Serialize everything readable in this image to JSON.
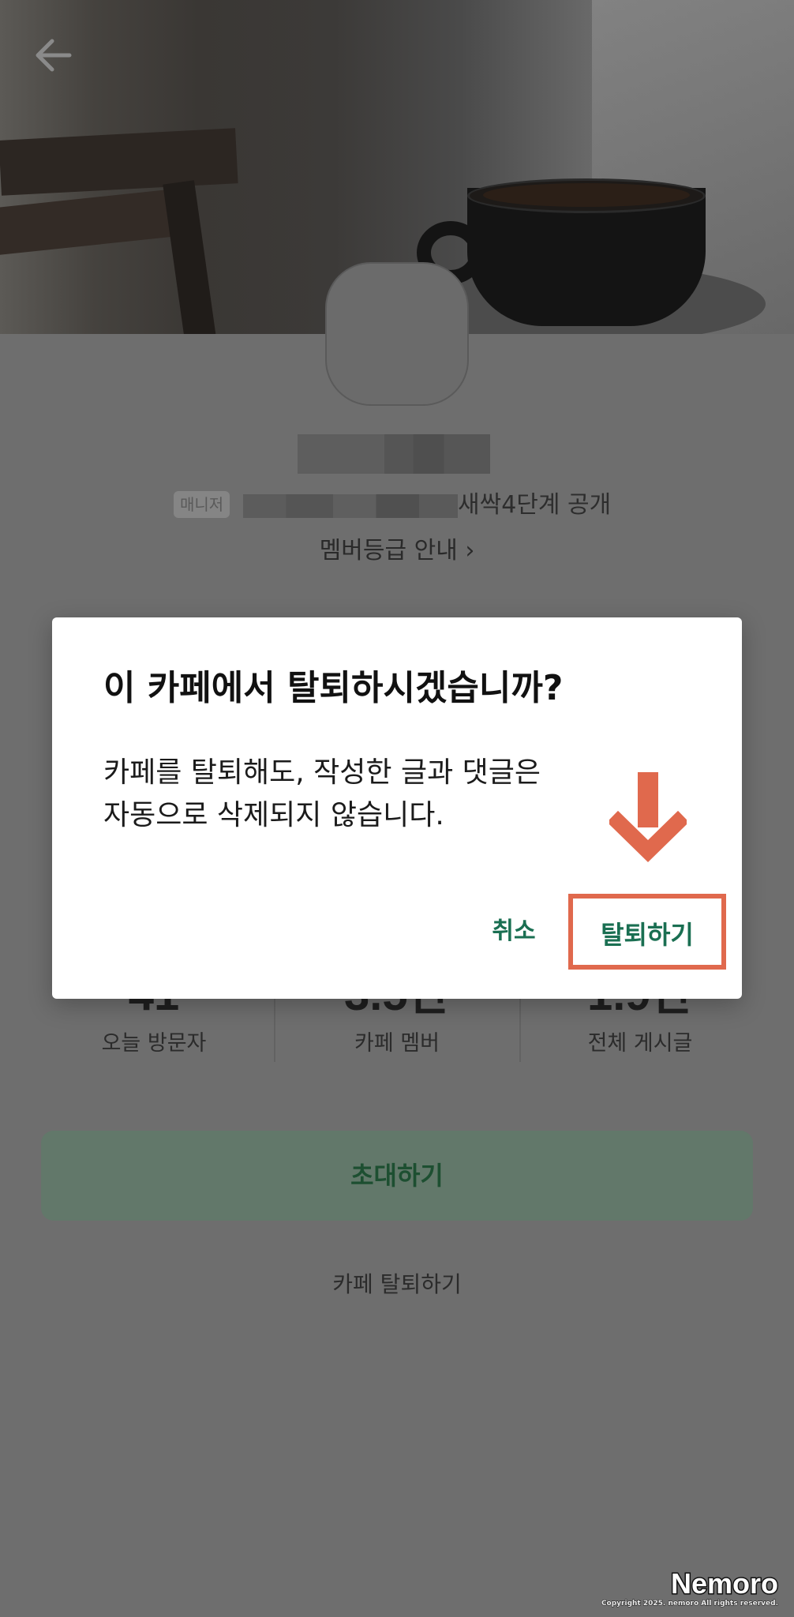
{
  "header": {
    "back_label": ""
  },
  "profile": {
    "manager_badge": "매니저",
    "cafe_meta": "새싹4단계 공개",
    "member_grade_link": "멤버등급 안내 ›"
  },
  "stats": [
    {
      "value": "41",
      "label": "오늘 방문자"
    },
    {
      "value": "3.5만",
      "label": "카페 멤버"
    },
    {
      "value": "1.9만",
      "label": "전체 게시글"
    }
  ],
  "actions": {
    "invite_label": "초대하기",
    "leave_label": "카페 탈퇴하기"
  },
  "dialog": {
    "title": "이 카페에서 탈퇴하시겠습니까?",
    "message_line1": "카페를 탈퇴해도, 작성한 글과 댓글은",
    "message_line2": "자동으로 삭제되지 않습니다.",
    "cancel_label": "취소",
    "confirm_label": "탈퇴하기"
  },
  "watermark": {
    "brand": "Nemoro",
    "copyright": "Copyright 2025. nemoro All rights reserved."
  },
  "colors": {
    "accent_green": "#1a6f52",
    "annotation_red": "#e0694d",
    "overlay_gray": "#6e6e6e"
  },
  "icons": [
    "arrow-left-icon",
    "chevron-right-icon",
    "arrow-down-annotation-icon"
  ]
}
